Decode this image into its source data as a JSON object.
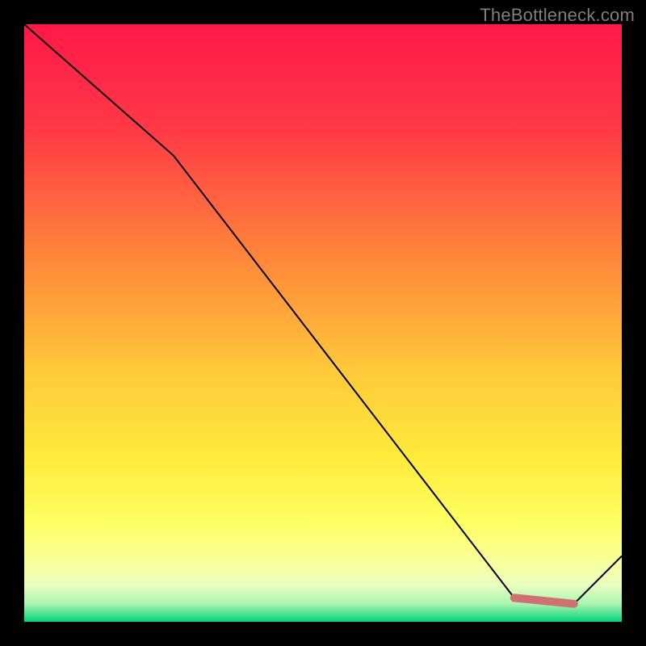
{
  "watermark": "TheBottleneck.com",
  "colors": {
    "gradient_top": "#ff1848",
    "gradient_mid1": "#ff7a3a",
    "gradient_mid2": "#ffd83a",
    "gradient_mid3": "#ffff60",
    "gradient_mid4": "#f5ffb0",
    "gradient_bottom": "#00d479",
    "line": "#000000",
    "highlight": "#d17070",
    "frame": "#000000"
  },
  "chart_data": {
    "type": "line",
    "title": "",
    "xlabel": "",
    "ylabel": "",
    "xlim": [
      0,
      100
    ],
    "ylim": [
      0,
      100
    ],
    "series": [
      {
        "name": "curve",
        "x": [
          0,
          25,
          82,
          92,
          100
        ],
        "y": [
          100,
          78,
          4,
          3,
          11
        ]
      }
    ],
    "highlight_segment": {
      "x": [
        82,
        92
      ],
      "y": [
        4,
        3
      ]
    }
  }
}
